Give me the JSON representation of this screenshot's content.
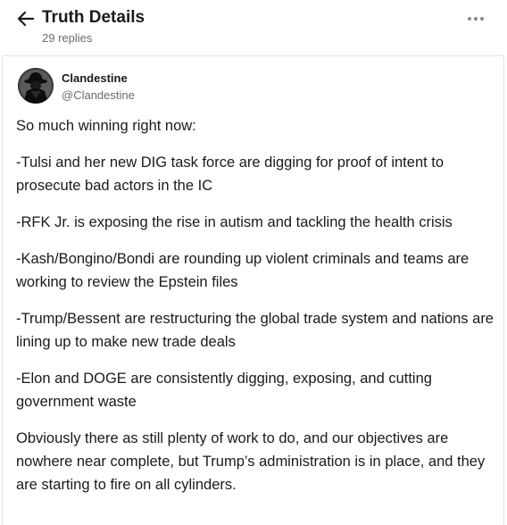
{
  "header": {
    "title": "Truth Details",
    "replies": "29 replies",
    "back_icon": "arrow-left-icon",
    "more_icon": "more-horizontal-icon"
  },
  "post": {
    "author": {
      "name": "Clandestine",
      "handle": "@Clandestine",
      "avatar_icon": "spy-silhouette-avatar"
    },
    "paragraphs": [
      "So much winning right now:",
      "-Tulsi and her new DIG task force are digging for proof of intent to prosecute bad actors in the IC",
      "-RFK Jr. is exposing the rise in autism and tackling the health crisis",
      "-Kash/Bongino/Bondi are rounding up violent criminals and teams are working to review the Epstein files",
      "-Trump/Bessent are restructuring the global trade system and nations are lining up to make new trade deals",
      "-Elon and DOGE are consistently digging, exposing, and cutting government waste",
      "Obviously there as still plenty of work to do, and our objectives are nowhere near complete, but Trump’s administration is in place, and they are starting to fire on all cylinders."
    ]
  },
  "colors": {
    "text": "#1a1a1a",
    "muted": "#6b6b6b",
    "border": "#e4e4e4"
  }
}
